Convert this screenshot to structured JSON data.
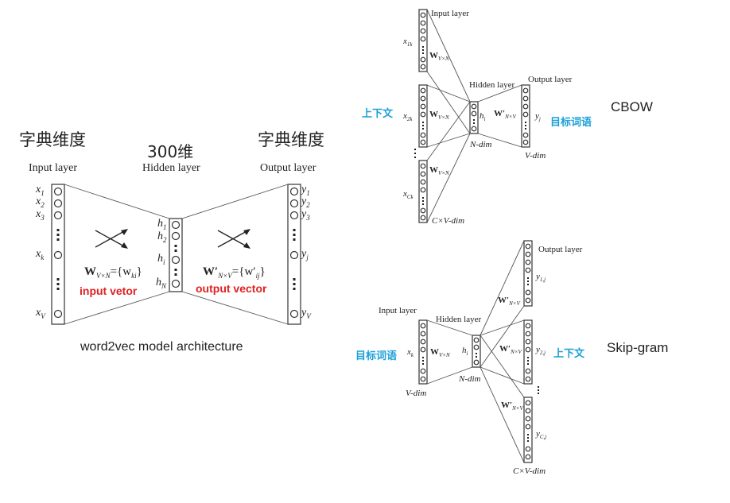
{
  "main": {
    "dim_left": "字典维度",
    "dim_mid": "300维",
    "dim_right": "字典维度",
    "input_layer": "Input layer",
    "hidden_layer": "Hidden layer",
    "output_layer": "Output layer",
    "x_labels": [
      "x",
      "x",
      "x",
      "x",
      "x"
    ],
    "x_subs": [
      "1",
      "2",
      "3",
      "k",
      "V"
    ],
    "y_labels": [
      "y",
      "y",
      "y",
      "y",
      "y"
    ],
    "y_subs": [
      "1",
      "2",
      "3",
      "j",
      "V"
    ],
    "h_labels": [
      "h",
      "h",
      "h",
      "h"
    ],
    "h_subs": [
      "1",
      "2",
      "i",
      "N"
    ],
    "w_in": "W",
    "w_in_sub": "V×N",
    "w_in_eq": "={w",
    "w_in_eq_sub": "ki",
    "w_in_close": "}",
    "w_out": "W′",
    "w_out_sub": "N×V",
    "w_out_eq": "={w′",
    "w_out_eq_sub": "ij",
    "w_out_close": "}",
    "input_vector_label": "input vetor",
    "output_vector_label": "output vector",
    "caption": "word2vec model architecture"
  },
  "cbow": {
    "title": "CBOW",
    "input_layer": "Input layer",
    "hidden_layer": "Hidden layer",
    "output_layer": "Output layer",
    "x1": "x",
    "x1_sub": "1k",
    "x2": "x",
    "x2_sub": "2k",
    "xc": "x",
    "xc_sub": "Ck",
    "w": "W",
    "w_sub": "V×N",
    "w_out": "W′",
    "w_out_sub": "N×V",
    "h": "h",
    "h_sub": "i",
    "y": "y",
    "y_sub": "j",
    "ndim": "N-dim",
    "vdim": "V-dim",
    "cvdim": "C×V-dim",
    "context_label": "上下文",
    "target_label": "目标词语"
  },
  "skipgram": {
    "title": "Skip-gram",
    "input_layer": "Input layer",
    "hidden_layer": "Hidden layer",
    "output_layer": "Output layer",
    "x": "x",
    "x_sub": "k",
    "w": "W",
    "w_sub": "V×N",
    "w_out": "W′",
    "w_out_sub": "N×V",
    "h": "h",
    "h_sub": "i",
    "y1": "y",
    "y1_sub": "1,j",
    "y2": "y",
    "y2_sub": "2,j",
    "yc": "y",
    "yc_sub": "C,j",
    "ndim": "N-dim",
    "vdim": "V-dim",
    "cvdim": "C×V-dim",
    "target_label": "目标词语",
    "context_label": "上下文"
  }
}
